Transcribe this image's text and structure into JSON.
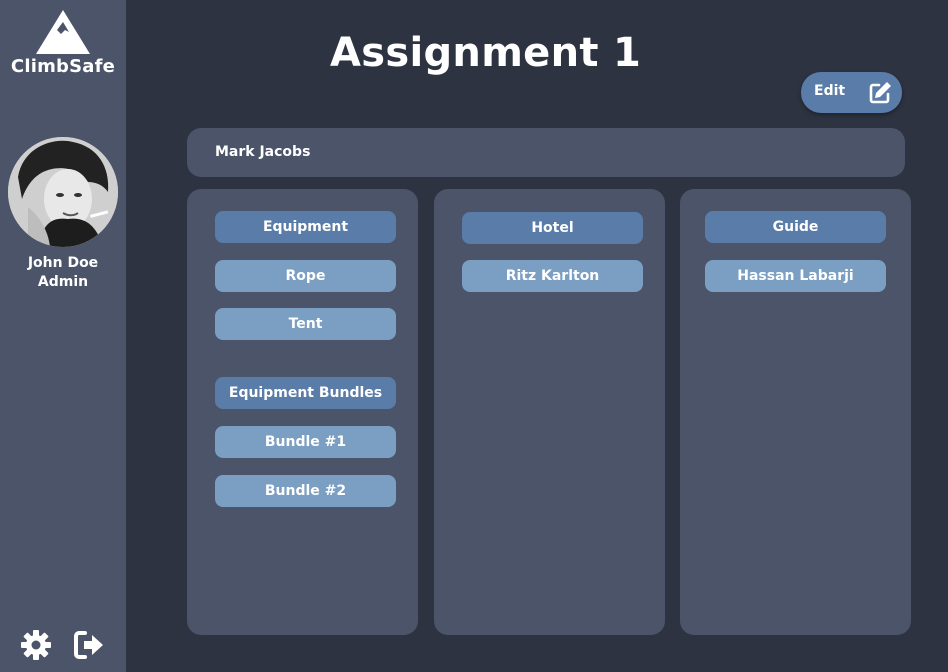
{
  "sidebar": {
    "brand": "ClimbSafe",
    "user": {
      "name": "John Doe",
      "role": "Admin"
    },
    "icons": {
      "settings": "gear-icon",
      "logout": "logout-icon"
    }
  },
  "main": {
    "title": "Assignment 1",
    "edit_label": "Edit",
    "client_name": "Mark Jacobs",
    "equipment": {
      "header": "Equipment",
      "items": [
        "Rope",
        "Tent"
      ],
      "bundles_header": "Equipment Bundles",
      "bundles": [
        "Bundle #1",
        "Bundle #2"
      ]
    },
    "hotel": {
      "header": "Hotel",
      "items": [
        "Ritz Karlton"
      ]
    },
    "guide": {
      "header": "Guide",
      "items": [
        "Hassan Labarji"
      ]
    }
  },
  "colors": {
    "background": "#2e3341",
    "panel": "#4b5468",
    "header_pill": "#5a7ca8",
    "item_pill": "#7b9ec3"
  }
}
